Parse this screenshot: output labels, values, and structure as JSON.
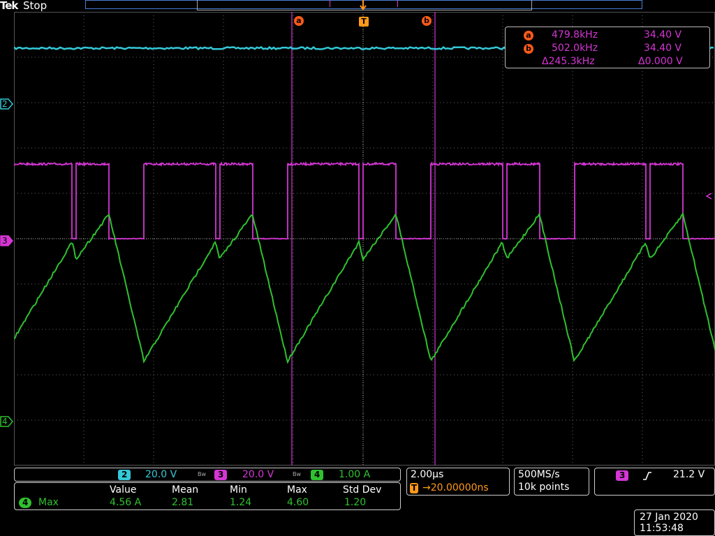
{
  "header": {
    "brand": "Tek",
    "status": "Stop"
  },
  "markers": {
    "cursor_a": "a",
    "cursor_b": "b",
    "trigger": "T"
  },
  "channels": {
    "ch2": {
      "label": "2",
      "color": "#34c9d8",
      "scale": "20.0 V"
    },
    "ch3": {
      "label": "3",
      "color": "#d436d4",
      "scale": "20.0 V"
    },
    "ch4": {
      "label": "4",
      "color": "#2fc12f",
      "scale": "1.00 A"
    },
    "bw_symbol": "Bw"
  },
  "cursor_readout": {
    "a": {
      "freq": "479.8kHz",
      "volt": "34.40 V"
    },
    "b": {
      "freq": "502.0kHz",
      "volt": "34.40 V"
    },
    "delta": {
      "freq": "Δ245.3kHz",
      "volt": "Δ0.000 V"
    }
  },
  "measurement": {
    "label": "Max",
    "headers": [
      "Value",
      "Mean",
      "Min",
      "Max",
      "Std Dev"
    ],
    "values": [
      "4.56 A",
      "2.81",
      "1.24",
      "4.60",
      "1.20"
    ]
  },
  "horizontal": {
    "scale": "2.00µs",
    "delay": "→20.00000ns"
  },
  "acquisition": {
    "rate": "500MS/s",
    "points": "10k points"
  },
  "trigger": {
    "channel": "3",
    "level": "21.2 V",
    "slope_icon": "rising-edge-icon"
  },
  "datetime": {
    "date": "27 Jan  2020",
    "time": "11:53:48"
  }
}
